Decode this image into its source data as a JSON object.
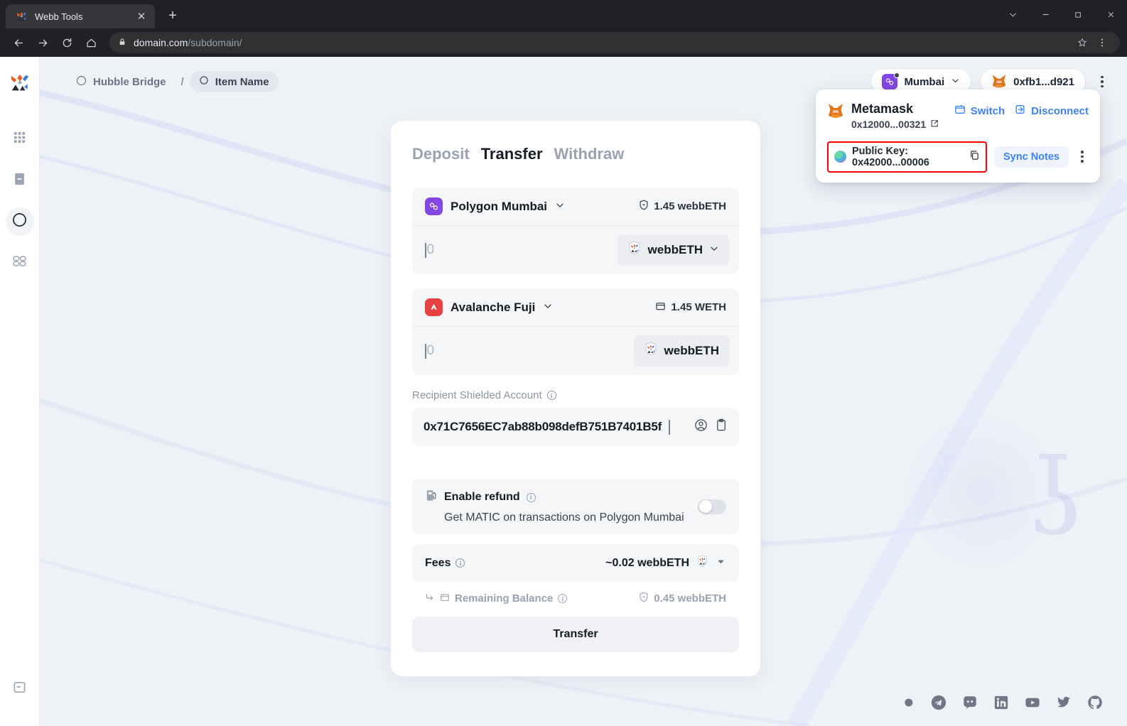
{
  "browser": {
    "tab_title": "Webb Tools",
    "tab_favicon": "webb-logo-icon",
    "new_tab_label": "+",
    "url_main": "domain.com",
    "url_sub": "/subdomain/",
    "window_controls": [
      "chevron-down",
      "minimize",
      "maximize",
      "close"
    ]
  },
  "sidebar": {
    "logo": "webb-logo",
    "items": [
      {
        "name": "grid-icon"
      },
      {
        "name": "document-icon"
      },
      {
        "name": "bridge-icon",
        "active": true
      },
      {
        "name": "pool-icon"
      }
    ],
    "bottom_item": {
      "name": "collapse-panel-icon"
    }
  },
  "topbar": {
    "breadcrumb": [
      {
        "label": "Hubble Bridge",
        "icon": "bridge-circle-icon"
      },
      {
        "label": "Item Name",
        "icon": "circle-icon"
      }
    ],
    "separator": "/",
    "network": {
      "label": "Mumbai",
      "icon": "polygon-icon"
    },
    "account": {
      "label": "0xfb1...d921",
      "icon": "metamask-fox-icon"
    },
    "more_menu": "kebab-menu-icon"
  },
  "account_panel": {
    "wallet_name": "Metamask",
    "wallet_address": "0x12000...00321",
    "switch_label": "Switch",
    "disconnect_label": "Disconnect",
    "public_key_label": "Public Key: 0x42000...00006",
    "sync_notes_label": "Sync Notes",
    "highlight_color": "#ff0000"
  },
  "bridge": {
    "tabs": [
      {
        "label": "Deposit",
        "active": false
      },
      {
        "label": "Transfer",
        "active": true
      },
      {
        "label": "Withdraw",
        "active": false
      }
    ],
    "source": {
      "chain": "Polygon Mumbai",
      "balance": "1.45 webbETH",
      "balance_icon": "shield-icon",
      "amount_placeholder": "0",
      "token": "webbETH",
      "token_icon": "webb-shield-icon"
    },
    "destination": {
      "chain": "Avalanche Fuji",
      "balance": "1.45 WETH",
      "balance_icon": "wallet-icon",
      "amount_placeholder": "0",
      "token": "webbETH",
      "token_icon": "webb-shield-icon"
    },
    "recipient": {
      "label": "Recipient Shielded Account",
      "value": "0x71C7656EC7ab88b098defB751B7401B5f",
      "account_icon": "account-circle-icon",
      "paste_icon": "clipboard-icon"
    },
    "refund": {
      "title": "Enable refund",
      "subtitle": "Get MATIC on transactions on Polygon Mumbai",
      "icon": "gas-pump-icon",
      "enabled": false
    },
    "fees": {
      "label": "Fees",
      "value": "~0.02 webbETH",
      "token_icon": "webb-shield-icon",
      "expand_icon": "chevron-down-icon"
    },
    "remaining": {
      "label": "Remaining Balance",
      "value": "0.45 webbETH",
      "arrow_icon": "corner-arrow-icon",
      "wallet_icon": "wallet-icon",
      "shield_icon": "shield-icon"
    },
    "submit_label": "Transfer"
  },
  "footer": {
    "socials": [
      "commit-icon",
      "telegram-icon",
      "discord-icon",
      "linkedin-icon",
      "youtube-icon",
      "twitter-icon",
      "github-icon"
    ]
  },
  "watermark": {
    "glyph": "ʖ"
  },
  "colors": {
    "polygon": "#8247e5",
    "avalanche": "#e84142",
    "accent_blue": "#3b82f6",
    "page_bg": "#eef2f7",
    "card_bg": "#ffffff",
    "field_bg": "#f5f6f8"
  }
}
